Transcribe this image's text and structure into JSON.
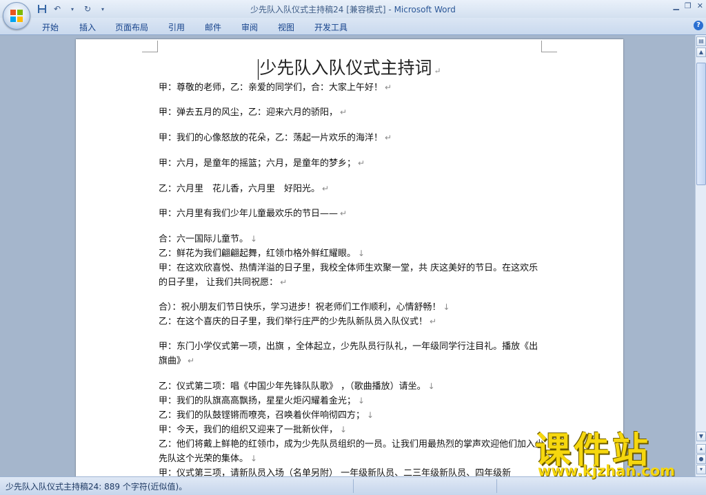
{
  "window": {
    "doc_name": "少先队入队仪式主持稿24 [兼容模式]",
    "separator": " - ",
    "app_name": "Microsoft Word"
  },
  "tabs": [
    "开始",
    "插入",
    "页面布局",
    "引用",
    "邮件",
    "审阅",
    "视图",
    "开发工具"
  ],
  "document": {
    "title": "少先队入队仪式主持词",
    "paragraphs": [
      "甲：尊敬的老师，乙：亲爱的同学们，合：大家上午好！",
      "甲：弹去五月的风尘，乙：迎来六月的骄阳，",
      "甲：我们的心像怒放的花朵，乙：荡起一片欢乐的海洋！",
      "甲：六月，是童年的摇篮；六月，是童年的梦乡；",
      "乙：六月里　花儿香，六月里　好阳光。",
      "甲：六月里有我们少年儿童最欢乐的节日——",
      "合：六一国际儿童节。",
      "乙：鲜花为我们翩翩起舞，红领巾格外鲜红耀眼。",
      "甲：在这欢欣喜悦、热情洋溢的日子里，我校全体师生欢聚一堂，共 庆这美好的节日。在这欢乐的日子里， 让我们共同祝愿：",
      "合）：祝小朋友们节日快乐，学习进步！祝老师们工作顺利，心情舒畅！",
      "乙：在这个喜庆的日子里，我们举行庄严的少先队新队员入队仪式！",
      " 甲：东门小学仪式第一项，出旗 ，全体起立，少先队员行队礼，一年级同学行注目礼。播放《出旗曲》",
      "乙：仪式第二项：唱《中国少年先锋队队歌》 ，（歌曲播放）请坐。",
      "甲：我们的队旗高高飘扬，星星火炬闪耀着金光；",
      "乙：我们的队鼓铿锵而嘹亮，召唤着伙伴响彻四方；",
      "甲：今天，我们的组织又迎来了一批新伙伴，",
      "乙：他们将戴上鲜艳的红领巾，成为少先队员组织的一员。让我们用最热烈的掌声欢迎他们加入少先队这个光荣的集体。",
      "甲：仪式第三项，请新队员入场（名单另附） 一年级新队员、二三年级新队员、四年级新"
    ],
    "marks": {
      "paragraph": "↵",
      "line_break": "↓"
    }
  },
  "status": {
    "text": "少先队入队仪式主持稿24: 889 个字符(近似值)。"
  },
  "watermark": {
    "brand": "课件站",
    "url": "www.kjzhan.com"
  },
  "colors": {
    "ribbon": "#dbe6f4",
    "tab_text": "#15428b",
    "background": "#a5b6cc",
    "watermark": "#f6d70e"
  }
}
